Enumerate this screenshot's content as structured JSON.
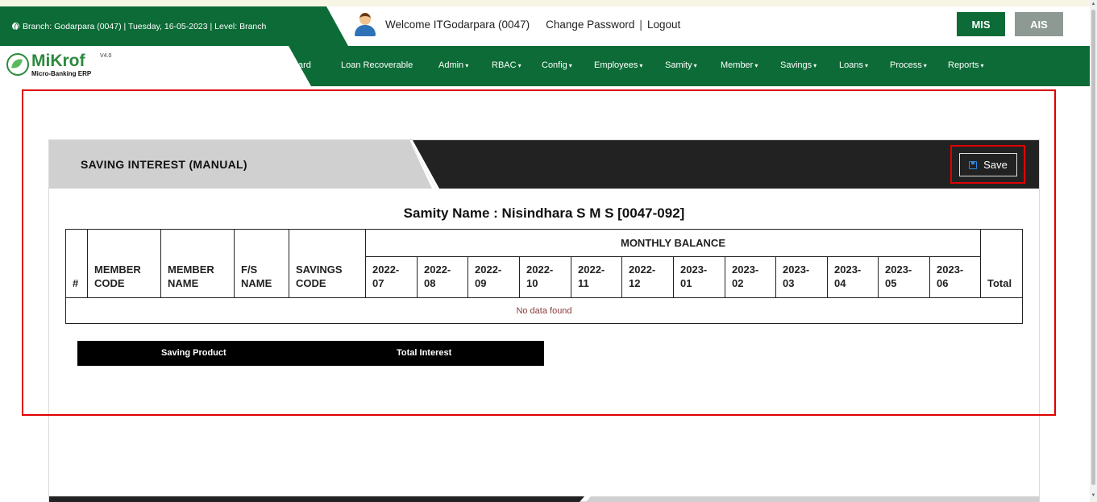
{
  "header": {
    "branch_info": "Branch: Godarpara (0047) | Tuesday, 16-05-2023 | Level: Branch",
    "welcome_text": "Welcome ITGodarpara (0047)",
    "change_password": "Change Password",
    "separator": "|",
    "logout": "Logout",
    "mis_label": "MIS",
    "ais_label": "AIS"
  },
  "logo": {
    "name": "MiKrof",
    "version": "V4.0",
    "subtitle": "Micro-Banking ERP"
  },
  "nav": {
    "items": [
      {
        "label": "ard",
        "caret": ""
      },
      {
        "label": "Loan Recoverable",
        "caret": ""
      },
      {
        "label": "Admin",
        "caret": "▾"
      },
      {
        "label": "RBAC",
        "caret": "▾"
      },
      {
        "label": "Config",
        "caret": "▾"
      },
      {
        "label": "Employees",
        "caret": "▾"
      },
      {
        "label": "Samity",
        "caret": "▾"
      },
      {
        "label": "Member",
        "caret": "▾"
      },
      {
        "label": "Savings",
        "caret": "▾"
      },
      {
        "label": "Loans",
        "caret": "▾"
      },
      {
        "label": "Process",
        "caret": "▾"
      },
      {
        "label": "Reports",
        "caret": "▾"
      }
    ]
  },
  "panel": {
    "title": "SAVING INTEREST (MANUAL)",
    "save_label": "Save",
    "samity_name": "Samity Name : Nisindhara S M S [0047-092]"
  },
  "table": {
    "col_hash": "#",
    "col_member_code": "MEMBER CODE",
    "col_member_name": "MEMBER NAME",
    "col_fs_name": "F/S NAME",
    "col_savings_code": "SAVINGS CODE",
    "monthly_balance": "MONTHLY BALANCE",
    "months": [
      "2022-07",
      "2022-08",
      "2022-09",
      "2022-10",
      "2022-11",
      "2022-12",
      "2023-01",
      "2023-02",
      "2023-03",
      "2023-04",
      "2023-05",
      "2023-06"
    ],
    "col_total": "Total",
    "empty_message": "No data found"
  },
  "summary": {
    "saving_product": "Saving Product",
    "total_interest": "Total Interest"
  },
  "colors": {
    "brand_green": "#0c6b36",
    "highlight_red": "#e00000",
    "dark_header": "#222222"
  }
}
